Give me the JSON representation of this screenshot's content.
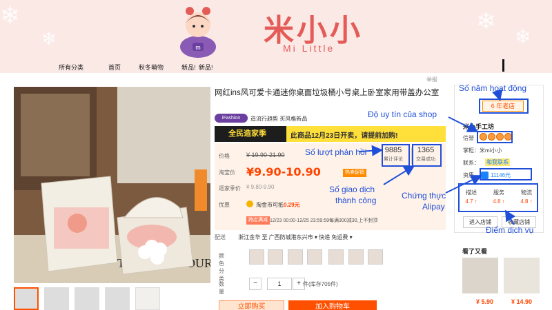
{
  "header": {
    "brand_cn": "米小小",
    "brand_en": "Mi Little"
  },
  "nav": {
    "items": [
      "所有分类",
      "首页",
      "秋冬萌物",
      "新品!",
      "新品!"
    ]
  },
  "report_label": "举报",
  "product": {
    "title": "网红ins风可爱卡通迷你桌面垃圾桶小号桌上卧室家用带盖办公室",
    "tag_pill": "iFashion",
    "tag_text": "造流行趋势 买风格新品",
    "promo_logo": "全民造家季",
    "promo_text": "此商品12月23日开卖，请提前加购!",
    "price_label": "价格",
    "price_old": "¥ 19.90-21.90",
    "taobao_label": "淘宝价",
    "price_now": "¥9.90-10.90",
    "hot_badge": "热卖促销",
    "coin_label": "逛家季价",
    "coin_price": "¥ 9.80-9.90",
    "benefit_label": "优惠",
    "coin_text_prefix": "淘金币可抵",
    "coin_text_value": "0.29元",
    "activity_badge": "跨店满减",
    "activity_text": "12/23 00:00-12/25 23:59:59每满300减30,上不封顶",
    "reviews": "9885",
    "reviews_label": "累计评论",
    "trades": "1365",
    "trades_label": "交易成功",
    "ship_label": "配送",
    "ship_text": "浙江金华  至  广西防城港东兴市 ▾    快递 免运费 ▾",
    "color_label": "颜色分类",
    "qty_label": "数量",
    "qty_minus": "−",
    "qty_value": "1",
    "qty_plus": "+",
    "stock_text": "件(库存705件)",
    "buy_label": "立即购买",
    "cart_label": "加入购物车"
  },
  "shop": {
    "years_badge": "6 年老店",
    "name": "米小手工坊",
    "rep_label": "信誉",
    "seller_label": "掌柜：",
    "seller_value": "米mi小小",
    "contact_label": "联系：",
    "contact_value": "和我联系",
    "quality_label": "资质",
    "alipay_value": "11146元",
    "scores": [
      {
        "name": "描述",
        "value": "4.7 ↑"
      },
      {
        "name": "服务",
        "value": "4.8 ↑"
      },
      {
        "name": "物流",
        "value": "4.8 ↑"
      }
    ],
    "enter_btn": "进入店铺",
    "fav_btn": "收藏店铺"
  },
  "also_seen": {
    "title": "看了又看",
    "prices": [
      "¥ 5.90",
      "¥ 14.90"
    ]
  },
  "annotations": {
    "years": "Số năm hoạt động",
    "reputation": "Độ uy tín của shop",
    "reviews": "Số lượt phản hồi",
    "trades_l1": "Số giao dịch",
    "trades_l2": "thành công",
    "alipay_l1": "Chứng thực",
    "alipay_l2": "Alipay",
    "service": "Điểm dịch vụ"
  },
  "colors": {
    "accent": "#ff5000",
    "brand": "#e45b57",
    "annotation": "#1f4fd8"
  }
}
